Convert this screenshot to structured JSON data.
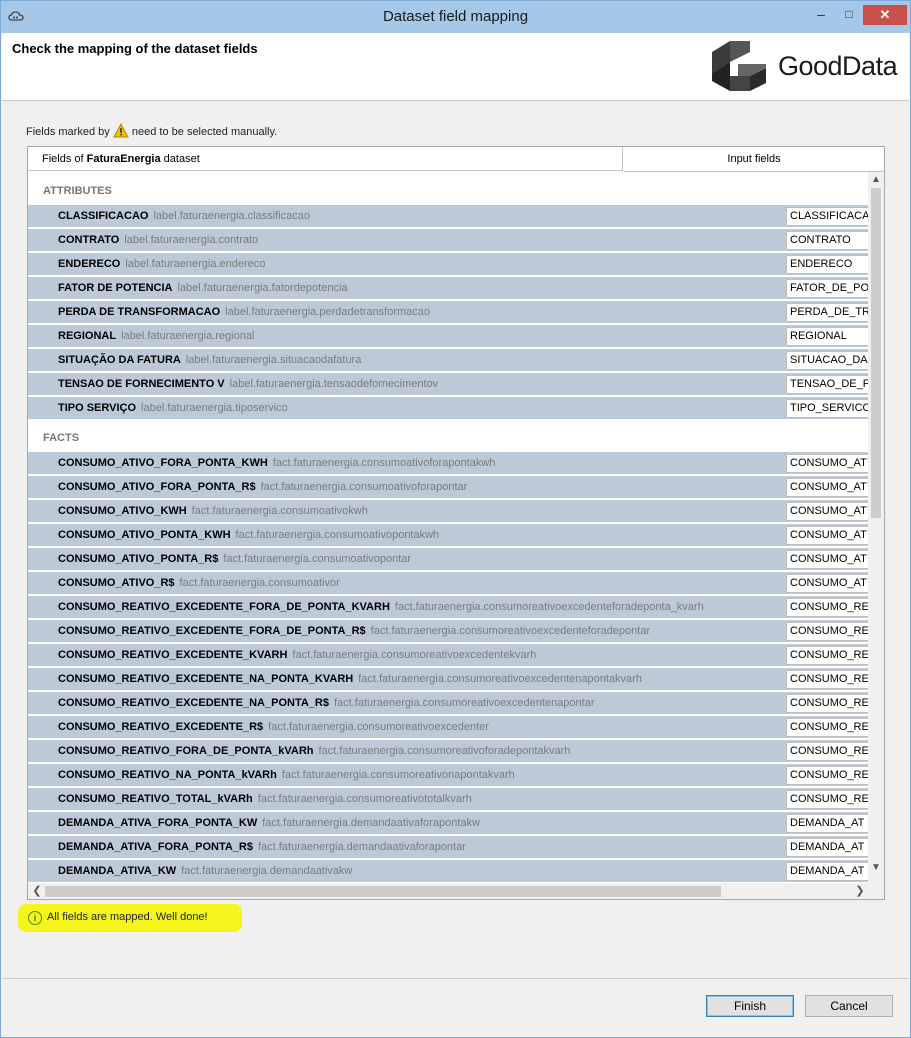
{
  "window": {
    "title": "Dataset field mapping",
    "minimize_label": "–",
    "maximize_label": "□",
    "close_label": "✕"
  },
  "header": {
    "title": "Check the mapping of the dataset fields",
    "logo_text": "GoodData"
  },
  "hint": {
    "prefix": "Fields marked by",
    "suffix": "need to be selected manually."
  },
  "table": {
    "col1_prefix": "Fields of ",
    "dataset_name": "FaturaEnergia",
    "col1_suffix": " dataset",
    "col2_header": "Input fields"
  },
  "sections": {
    "attributes": "ATTRIBUTES",
    "facts": "FACTS"
  },
  "attributes": [
    {
      "name": "CLASSIFICACAO",
      "id": "label.faturaenergia.classificacao",
      "input": "CLASSIFICACA"
    },
    {
      "name": "CONTRATO",
      "id": "label.faturaenergia.contrato",
      "input": "CONTRATO"
    },
    {
      "name": "ENDERECO",
      "id": "label.faturaenergia.endereco",
      "input": "ENDERECO"
    },
    {
      "name": "FATOR DE POTENCIA",
      "id": "label.faturaenergia.fatordepotencia",
      "input": "FATOR_DE_PO"
    },
    {
      "name": "PERDA DE TRANSFORMACAO",
      "id": "label.faturaenergia.perdadetransformacao",
      "input": "PERDA_DE_TRA"
    },
    {
      "name": "REGIONAL",
      "id": "label.faturaenergia.regional",
      "input": "REGIONAL"
    },
    {
      "name": "SITUAÇÃO DA FATURA",
      "id": "label.faturaenergia.situacaodafatura",
      "input": "SITUACAO_DA"
    },
    {
      "name": "TENSAO DE FORNECIMENTO V",
      "id": "label.faturaenergia.tensaodefornecimentov",
      "input": "TENSAO_DE_F"
    },
    {
      "name": "TIPO SERVIÇO",
      "id": "label.faturaenergia.tiposervico",
      "input": "TIPO_SERVICO"
    }
  ],
  "facts": [
    {
      "name": "CONSUMO_ATIVO_FORA_PONTA_KWH",
      "id": "fact.faturaenergia.consumoativoforapontakwh",
      "input": "CONSUMO_AT"
    },
    {
      "name": "CONSUMO_ATIVO_FORA_PONTA_R$",
      "id": "fact.faturaenergia.consumoativoforapontar",
      "input": "CONSUMO_AT"
    },
    {
      "name": "CONSUMO_ATIVO_KWH",
      "id": "fact.faturaenergia.consumoativokwh",
      "input": "CONSUMO_AT"
    },
    {
      "name": "CONSUMO_ATIVO_PONTA_KWH",
      "id": "fact.faturaenergia.consumoativopontakwh",
      "input": "CONSUMO_AT"
    },
    {
      "name": "CONSUMO_ATIVO_PONTA_R$",
      "id": "fact.faturaenergia.consumoativopontar",
      "input": "CONSUMO_AT"
    },
    {
      "name": "CONSUMO_ATIVO_R$",
      "id": "fact.faturaenergia.consumoativor",
      "input": "CONSUMO_AT"
    },
    {
      "name": "CONSUMO_REATIVO_EXCEDENTE_FORA_DE_PONTA_KVARH",
      "id": "fact.faturaenergia.consumoreativoexcedenteforadeponta_kvarh",
      "input": "CONSUMO_RE"
    },
    {
      "name": "CONSUMO_REATIVO_EXCEDENTE_FORA_DE_PONTA_R$",
      "id": "fact.faturaenergia.consumoreativoexcedenteforadepontar",
      "input": "CONSUMO_RE"
    },
    {
      "name": "CONSUMO_REATIVO_EXCEDENTE_KVARH",
      "id": "fact.faturaenergia.consumoreativoexcedentekvarh",
      "input": "CONSUMO_RE"
    },
    {
      "name": "CONSUMO_REATIVO_EXCEDENTE_NA_PONTA_KVARH",
      "id": "fact.faturaenergia.consumoreativoexcedentenapontakvarh",
      "input": "CONSUMO_RE"
    },
    {
      "name": "CONSUMO_REATIVO_EXCEDENTE_NA_PONTA_R$",
      "id": "fact.faturaenergia.consumoreativoexcedentenapontar",
      "input": "CONSUMO_RE"
    },
    {
      "name": "CONSUMO_REATIVO_EXCEDENTE_R$",
      "id": "fact.faturaenergia.consumoreativoexcedenter",
      "input": "CONSUMO_RE"
    },
    {
      "name": "CONSUMO_REATIVO_FORA_DE_PONTA_kVARh",
      "id": "fact.faturaenergia.consumoreativoforadepontakvarh",
      "input": "CONSUMO_RE"
    },
    {
      "name": "CONSUMO_REATIVO_NA_PONTA_kVARh",
      "id": "fact.faturaenergia.consumoreativonapontakvarh",
      "input": "CONSUMO_RE"
    },
    {
      "name": "CONSUMO_REATIVO_TOTAL_kVARh",
      "id": "fact.faturaenergia.consumoreativototalkvarh",
      "input": "CONSUMO_RE"
    },
    {
      "name": "DEMANDA_ATIVA_FORA_PONTA_KW",
      "id": "fact.faturaenergia.demandaativaforapontakw",
      "input": "DEMANDA_AT"
    },
    {
      "name": "DEMANDA_ATIVA_FORA_PONTA_R$",
      "id": "fact.faturaenergia.demandaativaforapontar",
      "input": "DEMANDA_AT"
    },
    {
      "name": "DEMANDA_ATIVA_KW",
      "id": "fact.faturaenergia.demandaativakw",
      "input": "DEMANDA_AT"
    }
  ],
  "status": {
    "icon": "info-icon",
    "text": "All fields are mapped. Well done!",
    "highlight_color": "#f5f51d"
  },
  "buttons": {
    "finish": "Finish",
    "cancel": "Cancel"
  },
  "colors": {
    "row_background": "#bccad8",
    "titlebar": "#a6c8e8",
    "close_button": "#c7504b"
  }
}
